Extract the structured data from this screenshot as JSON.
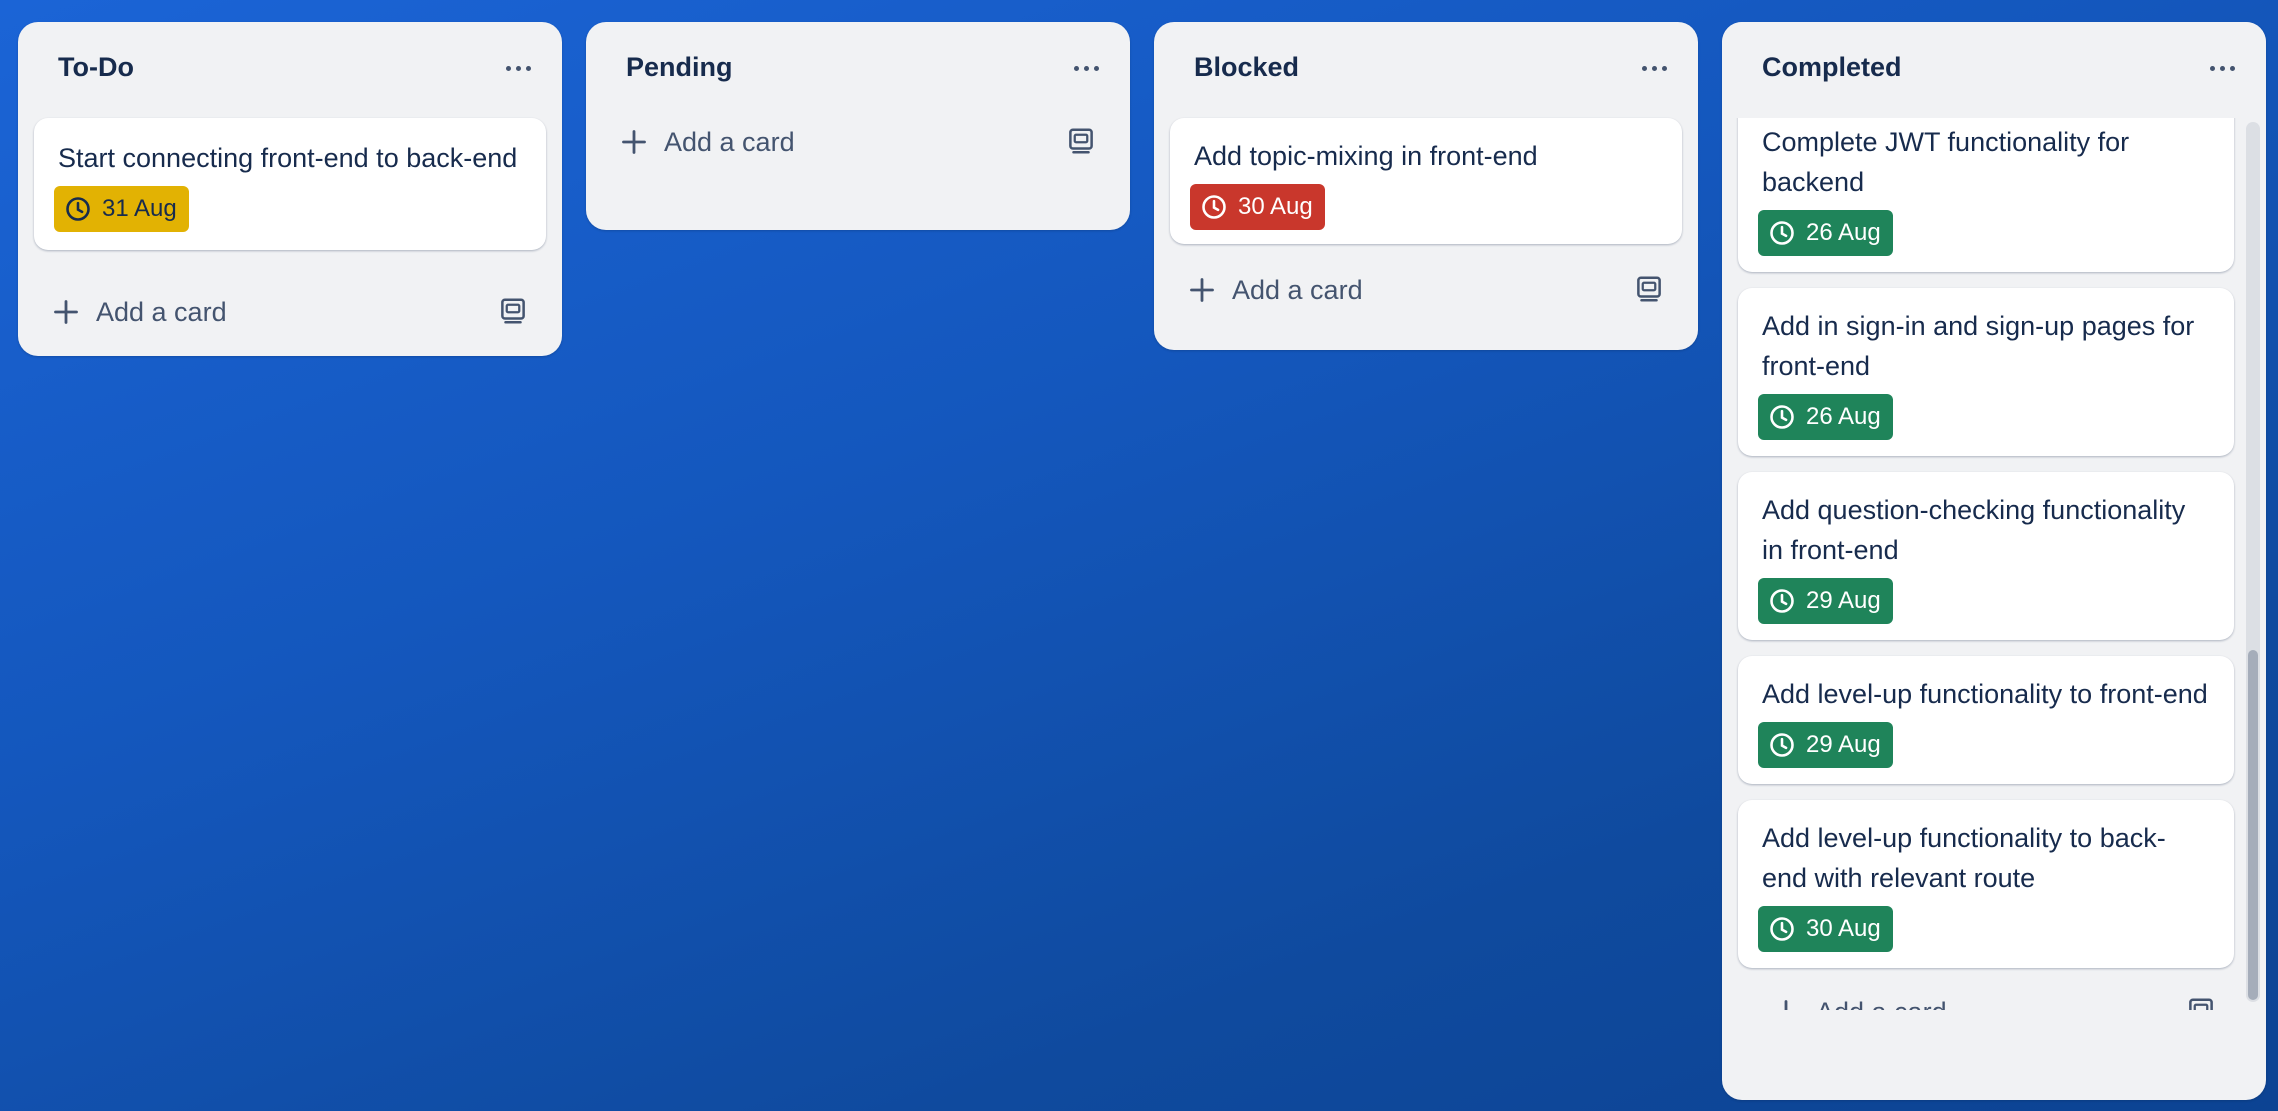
{
  "board": {
    "lists": [
      {
        "title": "To-Do",
        "cards": [
          {
            "title": "Start connecting front-end to back-end",
            "due": "31 Aug",
            "due_status": "due-soon"
          }
        ],
        "add_label": "Add a card"
      },
      {
        "title": "Pending",
        "cards": [],
        "add_label": "Add a card"
      },
      {
        "title": "Blocked",
        "cards": [
          {
            "title": "Add topic-mixing in front-end",
            "due": "30 Aug",
            "due_status": "overdue"
          }
        ],
        "add_label": "Add a card"
      },
      {
        "title": "Completed",
        "cards": [
          {
            "title": "Complete JWT functionality for backend",
            "due": "26 Aug",
            "due_status": "complete"
          },
          {
            "title": "Add in sign-in and sign-up pages for front-end",
            "due": "26 Aug",
            "due_status": "complete"
          },
          {
            "title": "Add question-checking functionality in front-end",
            "due": "29 Aug",
            "due_status": "complete"
          },
          {
            "title": "Add level-up functionality to front-end",
            "due": "29 Aug",
            "due_status": "complete"
          },
          {
            "title": "Add level-up functionality to back-end with relevant route",
            "due": "30 Aug",
            "due_status": "complete"
          }
        ],
        "add_label": "Add a card"
      }
    ]
  },
  "icons": {
    "menu": "ellipsis-icon",
    "add": "plus-icon",
    "template": "card-template-icon",
    "due": "clock-icon"
  },
  "colors": {
    "due_soon_bg": "#e2b203",
    "due_soon_text": "#172b4d",
    "overdue_bg": "#c9372c",
    "overdue_text": "#ffffff",
    "complete_bg": "#1f845a",
    "complete_text": "#ffffff"
  }
}
